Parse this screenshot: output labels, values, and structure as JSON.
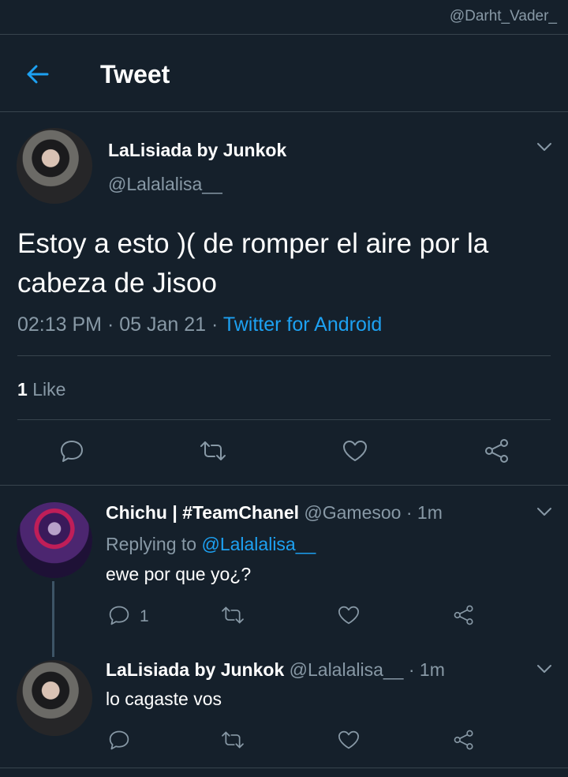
{
  "watermark": "@Darht_Vader_",
  "header": {
    "title": "Tweet",
    "back_icon": "arrow-left-icon",
    "accent": "#1da1f2"
  },
  "tweet": {
    "name": "LaLisiada by Junkok",
    "handle": "@Lalalalisa__",
    "text": "Estoy a esto )( de romper el aire por la cabeza de Jisoo",
    "time": "02:13 PM",
    "date": "05 Jan 21",
    "dot": "·",
    "source": "Twitter for Android",
    "likes_count": "1",
    "likes_label": "Like"
  },
  "replies": [
    {
      "name": "Chichu | #TeamChanel",
      "handle": "@Gamesoo",
      "time": "· 1m",
      "replying_prefix": "Replying to",
      "replying_to": "@Lalalalisa__",
      "text": "ewe por que yo¿?",
      "reply_count": "1"
    },
    {
      "name": "LaLisiada by Junkok",
      "handle": "@Lalalalisa__",
      "time": "· 1m",
      "text": "lo cagaste vos"
    }
  ],
  "colors": {
    "background": "#15202b",
    "muted": "#8899a6",
    "separator": "#38444d",
    "link": "#1da1f2"
  }
}
